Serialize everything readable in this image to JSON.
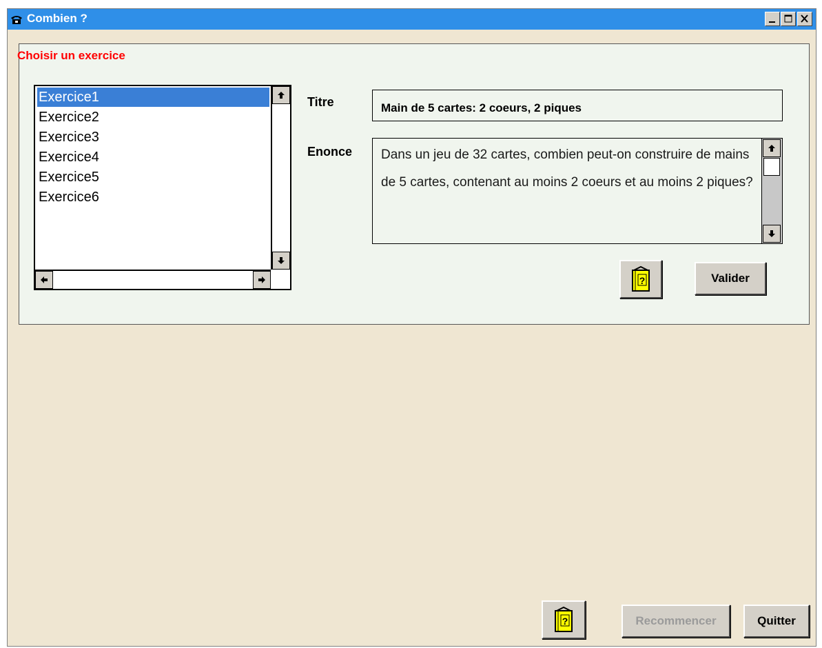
{
  "window": {
    "title": "Combien ?"
  },
  "exercise_panel": {
    "choose_label": "Choisir un exercice",
    "exercises": [
      "Exercice1",
      "Exercice2",
      "Exercice3",
      "Exercice4",
      "Exercice5",
      "Exercice6"
    ],
    "selected_index": 0
  },
  "fields": {
    "titre_label": "Titre",
    "titre_value": "Main de 5 cartes: 2 coeurs, 2 piques",
    "enonce_label": "Enonce",
    "enonce_value": "Dans un jeu de 32 cartes, combien peut-on construire de mains de 5 cartes, contenant au moins 2 coeurs et au moins 2 piques?"
  },
  "buttons": {
    "valider": "Valider",
    "recommencer": "Recommencer",
    "quitter": "Quitter"
  },
  "icons": {
    "app": "telephone-icon",
    "help": "help-book-icon"
  },
  "colors": {
    "titlebar": "#2f8fe8",
    "window_bg": "#efe6d2",
    "panel_bg": "#f0f5ee",
    "choose_label": "#ff0000",
    "selection": "#3a7fd6"
  }
}
